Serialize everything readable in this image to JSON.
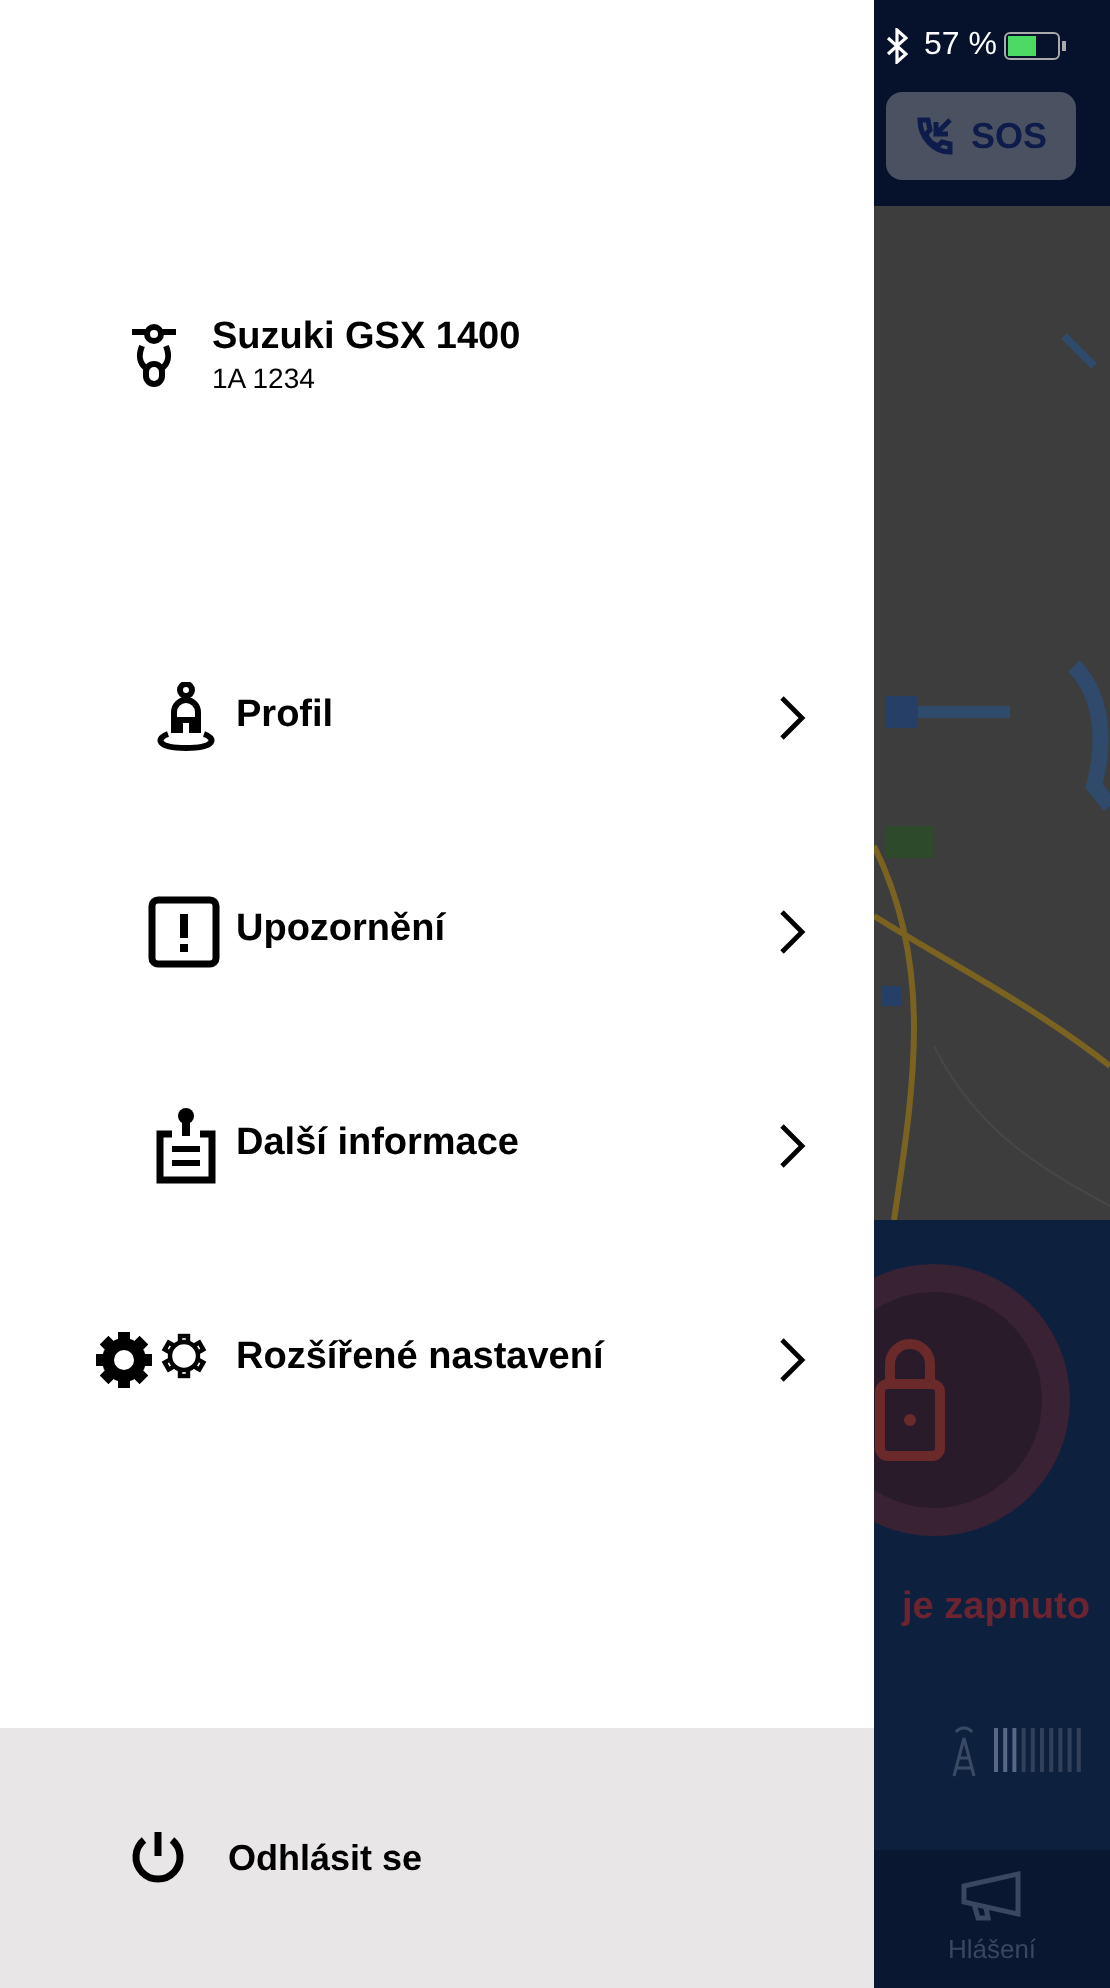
{
  "vehicle": {
    "name": "Suzuki GSX 1400",
    "plate": "1A 1234"
  },
  "menu": [
    {
      "kind": "profile",
      "label": "Profil"
    },
    {
      "kind": "alert",
      "label": "Upozornění"
    },
    {
      "kind": "info",
      "label": "Další informace"
    },
    {
      "kind": "settings",
      "label": "Rozšířené nastavení"
    }
  ],
  "logout": {
    "label": "Odhlásit se"
  },
  "background_app": {
    "status_bar": {
      "battery": "57 %"
    },
    "sos_button": "SOS",
    "lock_status": "je zapnuto",
    "tab": "Hlášení"
  }
}
